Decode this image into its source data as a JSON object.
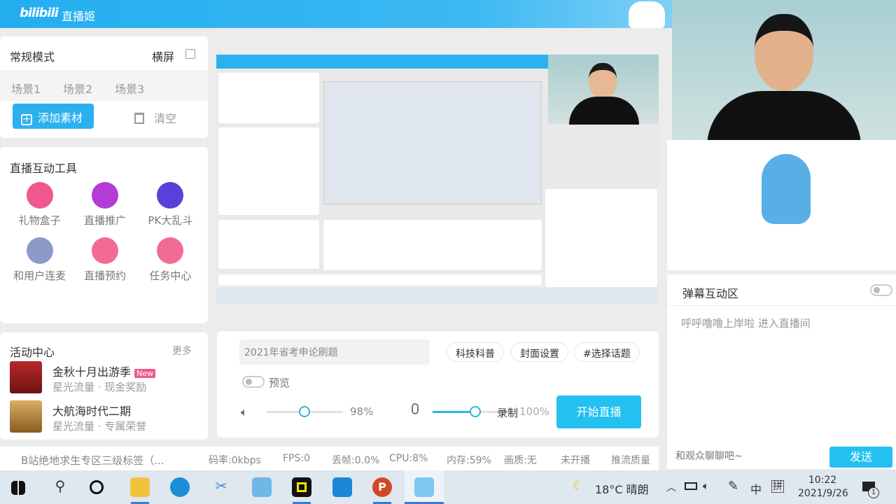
{
  "header": {
    "logo": "bilibili",
    "title": "直播姬"
  },
  "scene_card": {
    "mode": "常规模式",
    "orientation": "横屏",
    "scenes": [
      "场景1",
      "场景2",
      "场景3"
    ],
    "add_label": "添加素材",
    "clear_label": "清空"
  },
  "tools_card": {
    "title": "直播互动工具",
    "items": [
      {
        "label": "礼物盒子",
        "icon": "gift-icon",
        "color": "#f0588f"
      },
      {
        "label": "直播推广",
        "icon": "promote-icon",
        "color": "#b33bd6"
      },
      {
        "label": "PK大乱斗",
        "icon": "pk-icon",
        "color": "#5b3fd9"
      },
      {
        "label": "和用户连麦",
        "icon": "mic-link-icon",
        "color": "#8d99c9"
      },
      {
        "label": "直播预约",
        "icon": "reserve-icon",
        "color": "#f26b93"
      },
      {
        "label": "任务中心",
        "icon": "task-icon",
        "color": "#f26b93"
      }
    ]
  },
  "activity_card": {
    "title": "活动中心",
    "more": "更多",
    "items": [
      {
        "title": "金秋十月出游季",
        "badge": "New",
        "sub": "星光流量 · 现金奖励"
      },
      {
        "title": "大航海时代二期",
        "sub": "星光流量 · 专属荣誉"
      }
    ]
  },
  "controls": {
    "title_value": "2021年省考申论刷题",
    "tags": [
      "科技科普",
      "封面设置",
      "#选择话题"
    ],
    "preview_label": "预览",
    "speaker_volume": "98%",
    "speaker_level": 0.5,
    "mic_label": "录制",
    "mic_volume": "100%",
    "mic_level": 0.55,
    "start_label": "开始直播"
  },
  "status": {
    "tag": "B站绝地求生专区三级标签（...",
    "bitrate": "码率:0kbps",
    "fps": "FPS:0",
    "drop": "丢帧:0.0%",
    "cpu": "CPU:8%",
    "mem": "内存:59%",
    "quality": "画质:无",
    "live_state": "未开播",
    "push_quality": "推流质量"
  },
  "danmaku": {
    "title": "弹幕互动区",
    "message": "呼呼噜噜上岸啦 进入直播间",
    "input_placeholder": "和观众聊聊吧~",
    "send_label": "发送"
  },
  "taskbar": {
    "weather": "18°C 晴朗",
    "ime_lang": "中",
    "ime_mode": "拼",
    "time": "10:22",
    "date": "2021/9/26",
    "notif_count": "1"
  }
}
